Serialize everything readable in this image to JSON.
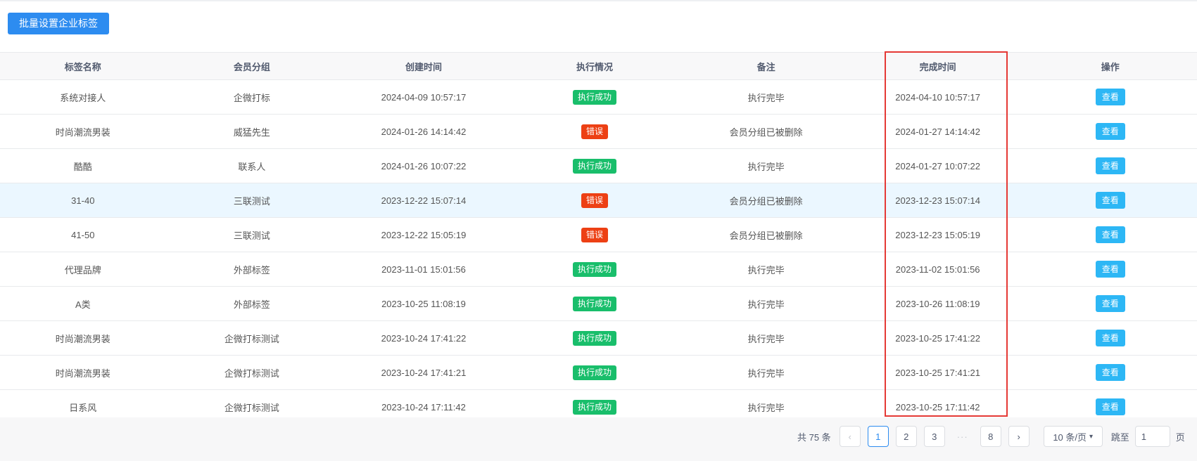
{
  "toolbar": {
    "batch_button": "批量设置企业标签"
  },
  "table": {
    "columns": [
      "标签名称",
      "会员分组",
      "创建时间",
      "执行情况",
      "备注",
      "完成时间",
      "操作"
    ],
    "rows": [
      {
        "name": "系统对接人",
        "group": "企微打标",
        "created": "2024-04-09 10:57:17",
        "status": "执行成功",
        "status_type": "success",
        "remark": "执行完毕",
        "finished": "2024-04-10 10:57:17",
        "action": "查看"
      },
      {
        "name": "时尚潮流男装",
        "group": "威猛先生",
        "created": "2024-01-26 14:14:42",
        "status": "错误",
        "status_type": "error",
        "remark": "会员分组已被删除",
        "finished": "2024-01-27 14:14:42",
        "action": "查看"
      },
      {
        "name": "酷酷",
        "group": "联系人",
        "created": "2024-01-26 10:07:22",
        "status": "执行成功",
        "status_type": "success",
        "remark": "执行完毕",
        "finished": "2024-01-27 10:07:22",
        "action": "查看"
      },
      {
        "name": "31-40",
        "group": "三联测试",
        "created": "2023-12-22 15:07:14",
        "status": "错误",
        "status_type": "error",
        "remark": "会员分组已被删除",
        "finished": "2023-12-23 15:07:14",
        "action": "查看"
      },
      {
        "name": "41-50",
        "group": "三联测试",
        "created": "2023-12-22 15:05:19",
        "status": "错误",
        "status_type": "error",
        "remark": "会员分组已被删除",
        "finished": "2023-12-23 15:05:19",
        "action": "查看"
      },
      {
        "name": "代理品牌",
        "group": "外部标签",
        "created": "2023-11-01 15:01:56",
        "status": "执行成功",
        "status_type": "success",
        "remark": "执行完毕",
        "finished": "2023-11-02 15:01:56",
        "action": "查看"
      },
      {
        "name": "A类",
        "group": "外部标签",
        "created": "2023-10-25 11:08:19",
        "status": "执行成功",
        "status_type": "success",
        "remark": "执行完毕",
        "finished": "2023-10-26 11:08:19",
        "action": "查看"
      },
      {
        "name": "时尚潮流男装",
        "group": "企微打标测试",
        "created": "2023-10-24 17:41:22",
        "status": "执行成功",
        "status_type": "success",
        "remark": "执行完毕",
        "finished": "2023-10-25 17:41:22",
        "action": "查看"
      },
      {
        "name": "时尚潮流男装",
        "group": "企微打标测试",
        "created": "2023-10-24 17:41:21",
        "status": "执行成功",
        "status_type": "success",
        "remark": "执行完毕",
        "finished": "2023-10-25 17:41:21",
        "action": "查看"
      },
      {
        "name": "日系风",
        "group": "企微打标测试",
        "created": "2023-10-24 17:11:42",
        "status": "执行成功",
        "status_type": "success",
        "remark": "执行完毕",
        "finished": "2023-10-25 17:11:42",
        "action": "查看"
      }
    ]
  },
  "pagination": {
    "total": "共 75 条",
    "prev_icon": "chevron-left-icon",
    "pages": [
      "1",
      "2",
      "3"
    ],
    "current": "1",
    "ellipsis": "···",
    "last_page": "8",
    "next_icon": "chevron-right-icon",
    "page_size": "10 条/页",
    "jump_label": "跳至",
    "jump_value": "1",
    "jump_suffix": "页"
  },
  "colors": {
    "primary": "#2d8cf0",
    "info": "#2db7f5",
    "success": "#19be6b",
    "error": "#ed4014",
    "highlight_box": "#e53935",
    "row_hover": "#ebf7ff"
  }
}
